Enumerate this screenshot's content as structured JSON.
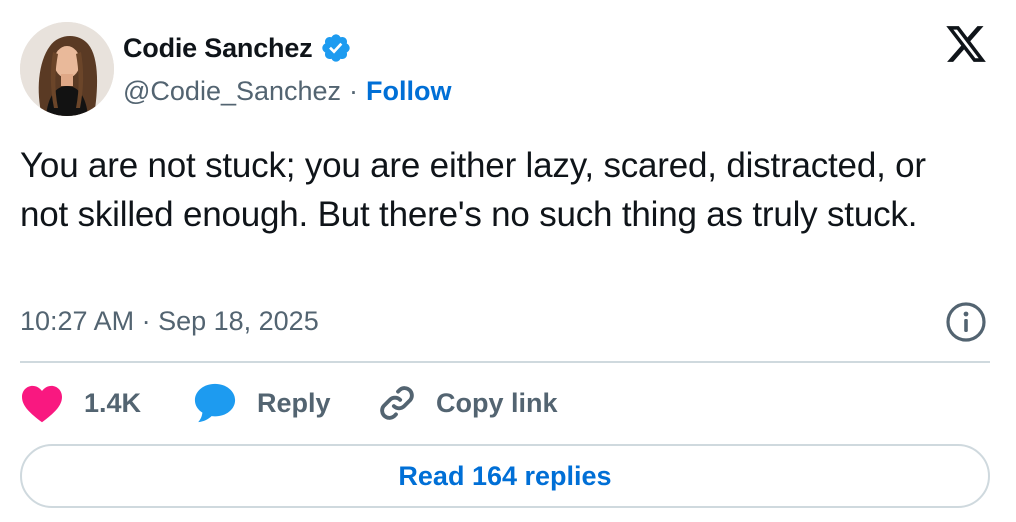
{
  "author": {
    "display_name": "Codie Sanchez",
    "handle": "@Codie_Sanchez",
    "separator": "·",
    "follow_label": "Follow",
    "verified": true
  },
  "tweet": {
    "text": "You are not stuck; you are either lazy, scared, distracted, or not skilled enough. But there's no such thing as truly stuck.",
    "timestamp": "10:27 AM · Sep 18, 2025"
  },
  "actions": {
    "like_count": "1.4K",
    "reply_label": "Reply",
    "copy_link_label": "Copy link"
  },
  "footer": {
    "read_replies_label": "Read 164 replies"
  },
  "icons": {
    "brand": "x-logo-icon",
    "verified": "verified-badge-icon",
    "info": "info-icon",
    "like": "heart-icon",
    "reply": "speech-bubble-icon",
    "copy": "link-icon"
  },
  "colors": {
    "text": "#0f1419",
    "secondary": "#536471",
    "link": "#006fd6",
    "verified": "#1d9bf0",
    "heart": "#f91880",
    "reply": "#1d9bf0",
    "border": "#cfd9de"
  }
}
